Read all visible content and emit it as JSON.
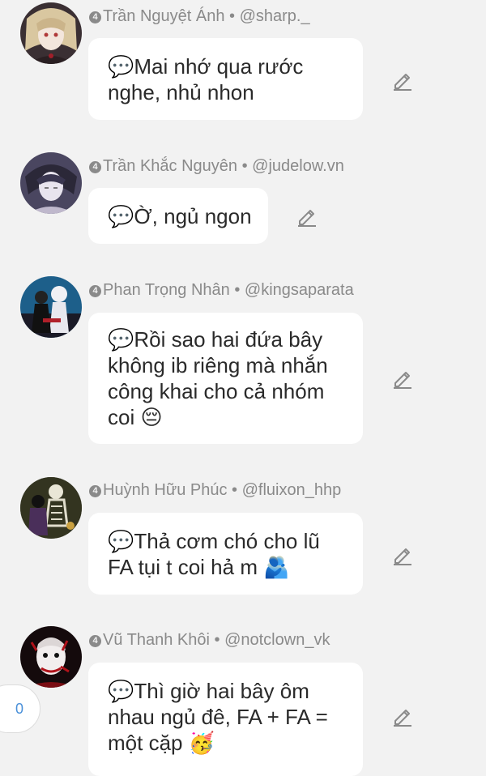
{
  "colors": {
    "background": "#f2f2f2",
    "bubble": "#ffffff",
    "meta_text": "#8a8a8a",
    "message_text": "#2a2a2a",
    "counter_text": "#4a90d9"
  },
  "messages": [
    {
      "badge": "4",
      "author": "Trần Nguyệt Ánh",
      "handle": "@sharp._",
      "lines": [
        "💬Mai nhớ qua rước",
        "nghe, nhủ nhon"
      ],
      "avatar": "avatar-blonde-character"
    },
    {
      "badge": "4",
      "author": "Trần Khắc Nguyên",
      "handle": "@judelow.vn",
      "lines": [
        "💬Ờ, ngủ ngon"
      ],
      "avatar": "avatar-dark-hair-character"
    },
    {
      "badge": "4",
      "author": "Phan Trọng Nhân",
      "handle": "@kingsaparata",
      "lines": [
        "💬Rồi sao hai đứa bây",
        "không ib riêng mà nhắn",
        "công khai cho cả nhóm",
        "coi 😔"
      ],
      "avatar": "avatar-two-figures"
    },
    {
      "badge": "4",
      "author": "Huỳnh Hữu Phúc",
      "handle": "@fluixon_hhp",
      "lines": [
        "💬Thả cơm chó cho lũ",
        "FA tụi t coi hả m 🫂"
      ],
      "avatar": "avatar-skeleton-art"
    },
    {
      "badge": "4",
      "author": "Vũ Thanh Khôi",
      "handle": "@notclown_vk",
      "lines": [
        "💬Thì giờ hai bây ôm",
        "nhau ngủ đê, FA + FA =",
        "một cặp 🥳"
      ],
      "avatar": "avatar-clown-red"
    }
  ],
  "counter": "0",
  "icons": {
    "edit": "pencil-icon"
  }
}
